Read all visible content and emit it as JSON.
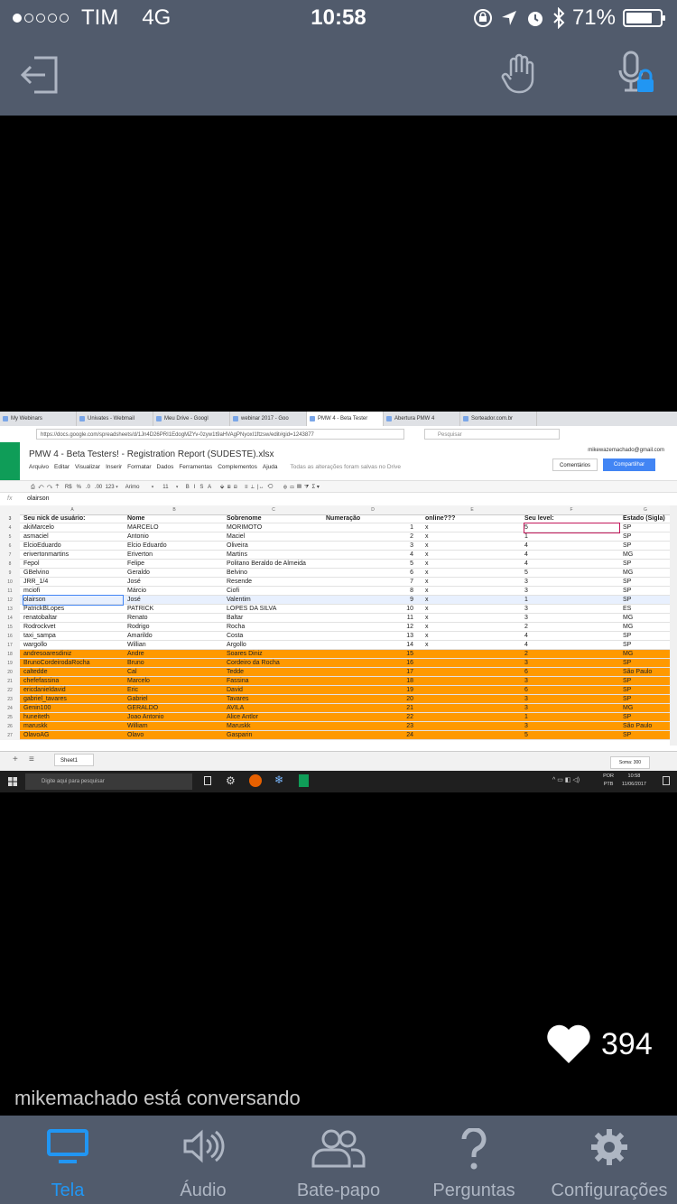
{
  "status": {
    "carrier": "TIM",
    "network": "4G",
    "time": "10:58",
    "battery": "71%",
    "signal_bars_of_5": 1,
    "battery_level_pct": 71
  },
  "toolbar_icons": [
    "exit-icon",
    "raise-hand-icon",
    "mic-locked-icon"
  ],
  "screen": {
    "browser_tabs": [
      "My Webinars",
      "Univates - Webmail",
      "Meu Drive - Googl",
      "webinar 2017 - Goo",
      "PMW 4 - Beta Tester",
      "Abertura PMW 4",
      "Sorteador.com.br"
    ],
    "url": "https://docs.google.com/spreadsheets/d/1Jn4D26PRI1EdogMZYv-0zyw1t9aHVAgPNyoxI1ftzsw/edit#gid=1243877",
    "search_placeholder": "Pesquisar",
    "doc_title": "PMW 4 - Beta Testers! - Registration Report (SUDESTE).xlsx",
    "menus": [
      "Arquivo",
      "Editar",
      "Visualizar",
      "Inserir",
      "Formatar",
      "Dados",
      "Ferramentas",
      "Complementos",
      "Ajuda"
    ],
    "saved_note": "Todas as alterações foram salvas no Drive",
    "email": "mikewazemachado@gmail.com",
    "comments_label": "Comentários",
    "share_label": "Compartilhar",
    "toolbar_text": "⎙  ↶  ↷  ⍑    R$   %   .0   .00  123 ▾     Arimo        ▾      11     ▾     B   I   S   A      ⬙  ⊞  ⊟     ≡  ⊥  |↔  ⟲       ⊕  ▭  ▥  ⧩  Σ ▾",
    "fx_label": "fx",
    "formula_value": "olairson",
    "col_letters": [
      "A",
      "B",
      "C",
      "D",
      "E",
      "F",
      "G"
    ],
    "header_row": {
      "n": "3",
      "a": "Seu nick de usuário:",
      "b": "Nome",
      "c": "Sobrenome",
      "d": "Numeração",
      "e": "online???",
      "f": "Seu level:",
      "g": "Estado (Sigla)"
    },
    "rows": [
      {
        "n": "4",
        "a": "akiMarcelo",
        "b": "MARCELO",
        "c": "MORIMOTO",
        "d": "1",
        "e": "x",
        "f": "5",
        "g": "SP",
        "style": ""
      },
      {
        "n": "5",
        "a": "asmaciel",
        "b": "Antonio",
        "c": "Maciel",
        "d": "2",
        "e": "x",
        "f": "1",
        "g": "SP",
        "style": ""
      },
      {
        "n": "6",
        "a": "ElcioEduardo",
        "b": "Elcio Eduardo",
        "c": "Oliveira",
        "d": "3",
        "e": "x",
        "f": "4",
        "g": "SP",
        "style": ""
      },
      {
        "n": "7",
        "a": "erivertonmartins",
        "b": "Eriverton",
        "c": "Martins",
        "d": "4",
        "e": "x",
        "f": "4",
        "g": "MG",
        "style": ""
      },
      {
        "n": "8",
        "a": "Fepol",
        "b": "Felipe",
        "c": "Politano Beraldo de Almeida",
        "d": "5",
        "e": "x",
        "f": "4",
        "g": "SP",
        "style": ""
      },
      {
        "n": "9",
        "a": "GBelvino",
        "b": "Geraldo",
        "c": "Belvino",
        "d": "6",
        "e": "x",
        "f": "5",
        "g": "MG",
        "style": ""
      },
      {
        "n": "10",
        "a": "JRR_1/4",
        "b": "José",
        "c": "Resende",
        "d": "7",
        "e": "x",
        "f": "3",
        "g": "SP",
        "style": ""
      },
      {
        "n": "11",
        "a": "mciofi",
        "b": "Márcio",
        "c": "Ciofi",
        "d": "8",
        "e": "x",
        "f": "3",
        "g": "SP",
        "style": ""
      },
      {
        "n": "12",
        "a": "olairson",
        "b": "José",
        "c": "Valentim",
        "d": "9",
        "e": "x",
        "f": "1",
        "g": "SP",
        "style": "sel"
      },
      {
        "n": "13",
        "a": "PatrickBLopes",
        "b": "PATRICK",
        "c": "LOPES DA SILVA",
        "d": "10",
        "e": "x",
        "f": "3",
        "g": "ES",
        "style": ""
      },
      {
        "n": "14",
        "a": "renatobaltar",
        "b": "Renato",
        "c": "Baltar",
        "d": "11",
        "e": "x",
        "f": "3",
        "g": "MG",
        "style": ""
      },
      {
        "n": "15",
        "a": "Rodrockvet",
        "b": "Rodrigo",
        "c": "Rocha",
        "d": "12",
        "e": "x",
        "f": "2",
        "g": "MG",
        "style": ""
      },
      {
        "n": "16",
        "a": "taxi_sampa",
        "b": "Amarildo",
        "c": "Costa",
        "d": "13",
        "e": "x",
        "f": "4",
        "g": "SP",
        "style": ""
      },
      {
        "n": "17",
        "a": "wargollo",
        "b": "Willian",
        "c": "Argollo",
        "d": "14",
        "e": "x",
        "f": "4",
        "g": "SP",
        "style": ""
      },
      {
        "n": "18",
        "a": "andresoaresdiniz",
        "b": "Andre",
        "c": "Soares Diniz",
        "d": "15",
        "e": "",
        "f": "2",
        "g": "MG",
        "style": "org"
      },
      {
        "n": "19",
        "a": "BrunoCordeirodaRocha",
        "b": "Bruno",
        "c": "Cordeiro da Rocha",
        "d": "16",
        "e": "",
        "f": "3",
        "g": "SP",
        "style": "org"
      },
      {
        "n": "20",
        "a": "caltedde",
        "b": "Cal",
        "c": "Tedde",
        "d": "17",
        "e": "",
        "f": "6",
        "g": "São Paulo",
        "style": "org"
      },
      {
        "n": "21",
        "a": "chefefassina",
        "b": "Marcelo",
        "c": "Fassina",
        "d": "18",
        "e": "",
        "f": "3",
        "g": "SP",
        "style": "org"
      },
      {
        "n": "22",
        "a": "ericdanieldavid",
        "b": "Eric",
        "c": "David",
        "d": "19",
        "e": "",
        "f": "6",
        "g": "SP",
        "style": "org"
      },
      {
        "n": "23",
        "a": "gabriel_tavares",
        "b": "Gabriel",
        "c": "Tavares",
        "d": "20",
        "e": "",
        "f": "3",
        "g": "SP",
        "style": "org"
      },
      {
        "n": "24",
        "a": "Genin100",
        "b": "GERALDO",
        "c": "AVILA",
        "d": "21",
        "e": "",
        "f": "3",
        "g": "MG",
        "style": "org"
      },
      {
        "n": "25",
        "a": "huneiteth",
        "b": "Joao Antonio",
        "c": "Alice Antlor",
        "d": "22",
        "e": "",
        "f": "1",
        "g": "SP",
        "style": "org"
      },
      {
        "n": "26",
        "a": "maruskk",
        "b": "William",
        "c": "Maruskk",
        "d": "23",
        "e": "",
        "f": "3",
        "g": "São Paulo",
        "style": "org"
      },
      {
        "n": "27",
        "a": "OlavoAG",
        "b": "Olavo",
        "c": "Gasparin",
        "d": "24",
        "e": "",
        "f": "5",
        "g": "SP",
        "style": "org"
      }
    ],
    "sheet_tab": "Sheet1",
    "sum_label": "Soma: 300",
    "taskbar_search": "Digite aqui para pesquisar",
    "taskbar_lang": "POR",
    "taskbar_lang2": "PTB",
    "taskbar_time": "10:58",
    "taskbar_date": "11/06/2017"
  },
  "likes": "394",
  "chat_note": "mikemachado está conversando",
  "nav": [
    {
      "label": "Tela",
      "icon": "monitor-icon",
      "active": true
    },
    {
      "label": "Áudio",
      "icon": "speaker-icon",
      "active": false
    },
    {
      "label": "Bate-papo",
      "icon": "people-icon",
      "active": false
    },
    {
      "label": "Perguntas",
      "icon": "question-icon",
      "active": false
    },
    {
      "label": "Configurações",
      "icon": "gear-icon",
      "active": false
    }
  ],
  "colors": {
    "bar": "#515b6c",
    "accent": "#2196f3",
    "highlight": "#ff9900",
    "nav_inactive": "#aeb6c3"
  }
}
